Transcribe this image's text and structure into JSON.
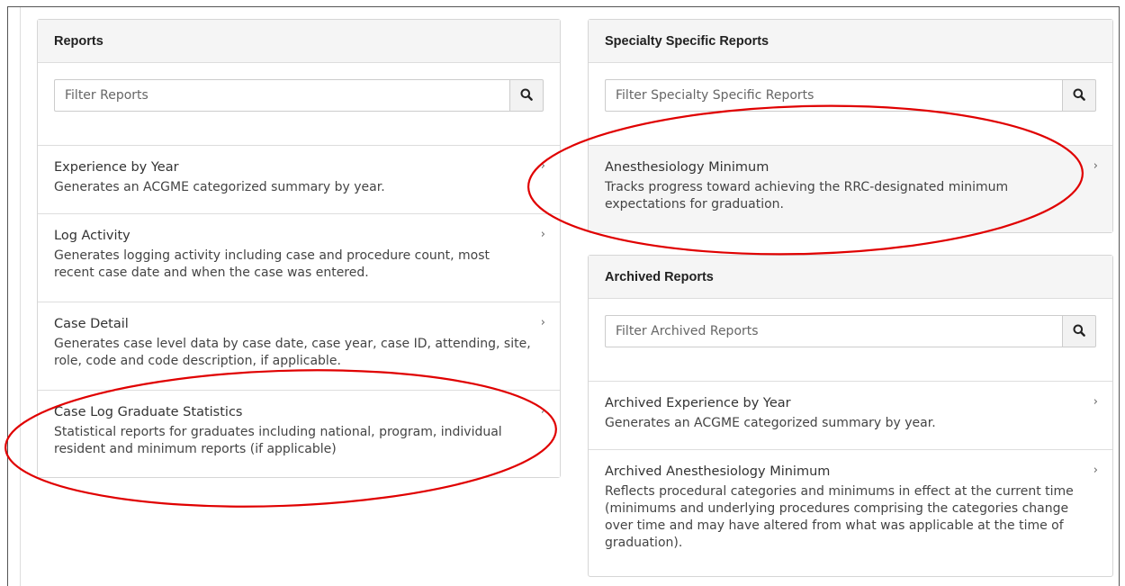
{
  "reports": {
    "heading": "Reports",
    "filter_placeholder": "Filter Reports",
    "items": [
      {
        "title": "Experience by Year",
        "description": "Generates an ACGME categorized summary by year."
      },
      {
        "title": "Log Activity",
        "description": "Generates logging activity including case and procedure count, most recent case date and when the case was entered."
      },
      {
        "title": "Case Detail",
        "description": "Generates case level data by case date, case year, case ID, attending, site, role, code and code description, if applicable."
      },
      {
        "title": "Case Log Graduate Statistics",
        "description": "Statistical reports for graduates including national, program, individual resident and minimum reports (if applicable)"
      }
    ]
  },
  "specialty": {
    "heading": "Specialty Specific Reports",
    "filter_placeholder": "Filter Specialty Specific Reports",
    "items": [
      {
        "title": "Anesthesiology Minimum",
        "description": "Tracks progress toward achieving the RRC-designated minimum expectations for graduation."
      }
    ]
  },
  "archived": {
    "heading": "Archived Reports",
    "filter_placeholder": "Filter Archived Reports",
    "items": [
      {
        "title": "Archived Experience by Year",
        "description": "Generates an ACGME categorized summary by year."
      },
      {
        "title": "Archived Anesthesiology Minimum",
        "description": "Reflects procedural categories and minimums in effect at the current time (minimums and underlying procedures comprising the categories change over time and may have altered from what was applicable at the time of graduation)."
      }
    ]
  },
  "icons": {
    "search": "search-icon",
    "chevron": "chevron-right-icon"
  },
  "colors": {
    "annotation": "#e00000",
    "panel_header_bg": "#f5f5f5",
    "border": "#dddddd"
  }
}
